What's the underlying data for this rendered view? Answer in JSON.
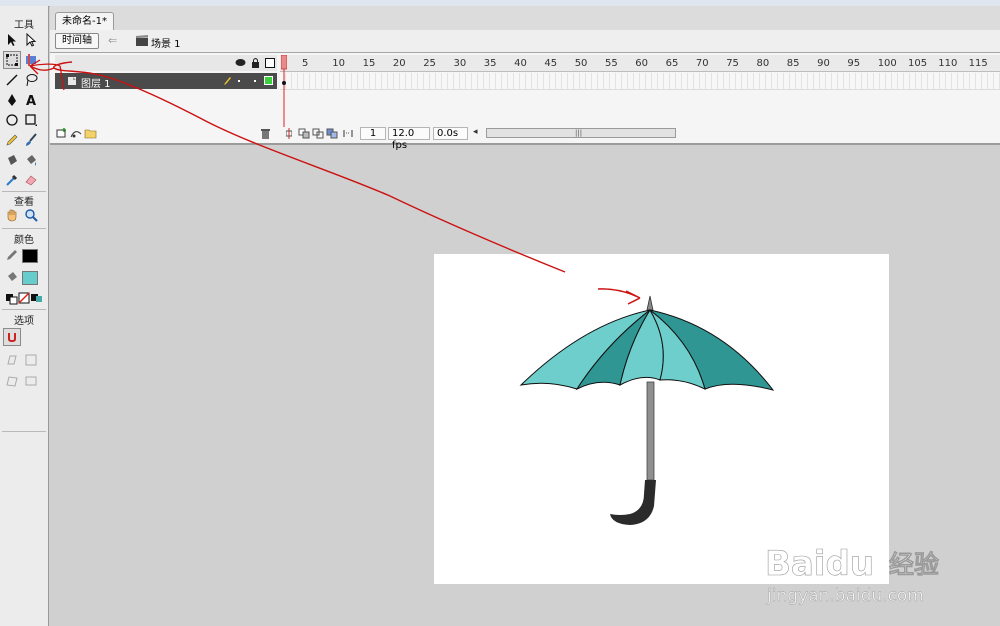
{
  "document": {
    "tab_title": "未命名-1*"
  },
  "edit_bar": {
    "timeline_button": "时间轴",
    "scene_label": "场景 1"
  },
  "toolbox": {
    "tools_header": "工具",
    "view_header": "查看",
    "colors_header": "颜色",
    "options_header": "选项",
    "stroke_color": "#000000",
    "fill_color": "#66cccc"
  },
  "timeline": {
    "layer_name": "图层 1",
    "ruler_numbers": [
      "5",
      "10",
      "15",
      "20",
      "25",
      "30",
      "35",
      "40",
      "45",
      "50",
      "55",
      "60",
      "65",
      "70",
      "75",
      "80",
      "85",
      "90",
      "95",
      "100",
      "105",
      "110",
      "115"
    ],
    "current_frame": "1",
    "frame_rate": "12.0 fps",
    "elapsed_time": "0.0s"
  },
  "watermark": {
    "brand": "Baidu",
    "brand_cn": "经验",
    "url": "jingyan.baidu.com"
  },
  "colors": {
    "umbrella_light": "#6dcecb",
    "umbrella_dark": "#2f9693",
    "annotation_red": "#cc1111"
  }
}
